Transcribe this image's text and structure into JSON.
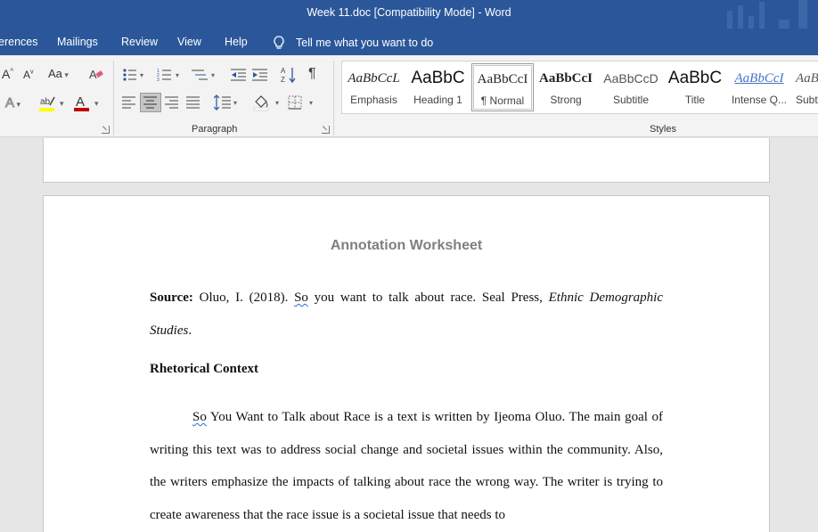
{
  "window": {
    "title": "Week 11.doc [Compatibility Mode]  -  Word"
  },
  "menu": {
    "tabs": [
      "erences",
      "Mailings",
      "Review",
      "View",
      "Help"
    ],
    "tell_me": "Tell me what you want to do"
  },
  "ribbon": {
    "font_group": {
      "grow_font": "A",
      "shrink_font": "A",
      "change_case": "Aa",
      "font_color_letter": "A",
      "text_effects_letter": "A"
    },
    "paragraph_group": {
      "label": "Paragraph",
      "pilcrow": "¶",
      "sort_az": "A↓Z"
    },
    "styles_group": {
      "label": "Styles",
      "items": [
        {
          "sample": "AaBbCcL",
          "name": "Emphasis"
        },
        {
          "sample": "AaBbC",
          "name": "Heading 1"
        },
        {
          "sample": "AaBbCcI",
          "name": "¶ Normal"
        },
        {
          "sample": "AaBbCcI",
          "name": "Strong"
        },
        {
          "sample": "AaBbCcD",
          "name": "Subtitle"
        },
        {
          "sample": "AaBbC",
          "name": "Title"
        },
        {
          "sample": "AaBbCcI",
          "name": "Intense Q..."
        },
        {
          "sample": "AaBbC",
          "name": "Subtl"
        }
      ],
      "selected": "¶ Normal"
    }
  },
  "document": {
    "title": "Annotation Worksheet",
    "source": {
      "label": "Source:",
      "citation_start": " Oluo, I. (2018). ",
      "so_word": "So",
      "citation_mid": " you want to talk about race. Seal Press, ",
      "journal": "Ethnic Demographic Studies",
      "citation_end": "."
    },
    "heading": "Rhetorical Context",
    "paragraph": {
      "so_word": "So",
      "text": " You Want to Talk about Race is a text is written by Ijeoma Oluo. The main goal of writing this text was to address social change and societal issues within the community. Also, the writers emphasize the impacts of talking about race the wrong way. The writer is trying to create awareness that the race issue is a societal issue that needs to"
    }
  },
  "colors": {
    "word_blue": "#2b579a",
    "ribbon_bg": "#f3f3f3",
    "canvas_bg": "#e6e6e6",
    "title_gray": "#7f7f7f",
    "font_color_red": "#c00000",
    "highlight_yellow": "#ffff00",
    "spell_squiggle": "#2b6ad9"
  },
  "icons": [
    "lightbulb-icon",
    "clear-formatting-icon",
    "bullets-icon",
    "numbering-icon",
    "multilevel-list-icon",
    "decrease-indent-icon",
    "increase-indent-icon",
    "sort-icon",
    "pilcrow-icon",
    "align-left-icon",
    "align-center-icon",
    "align-right-icon",
    "justify-icon",
    "line-spacing-icon",
    "shading-icon",
    "borders-icon",
    "highlight-icon",
    "font-color-icon",
    "text-effects-icon",
    "dialog-launcher-icon"
  ]
}
